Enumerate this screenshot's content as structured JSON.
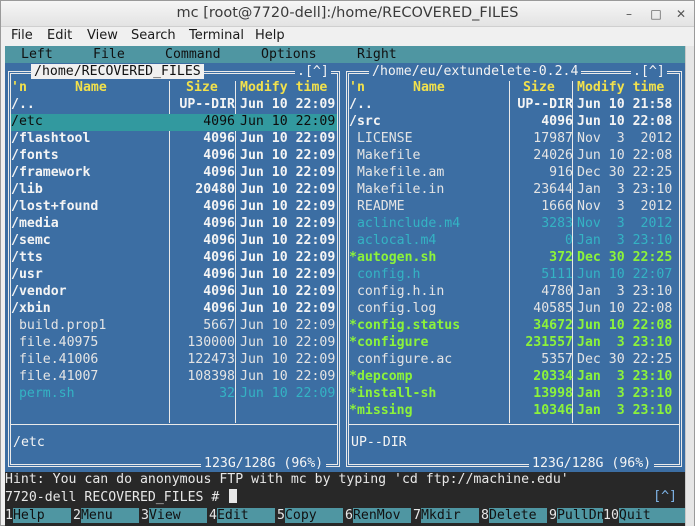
{
  "window": {
    "title": "mc [root@7720-dell]:/home/RECOVERED_FILES",
    "minimize": "–",
    "maximize": "□",
    "close": "✕"
  },
  "menubar": [
    "File",
    "Edit",
    "View",
    "Search",
    "Terminal",
    "Help"
  ],
  "mc_menu": [
    "Left",
    "File",
    "Command",
    "Options",
    "Right"
  ],
  "left_panel": {
    "path": "/home/RECOVERED_FILES",
    "corner": ".[^]",
    "headers": {
      "n": "'n",
      "name": "Name",
      "size": "Size",
      "mtime": "Modify time"
    },
    "rows": [
      {
        "name": "/..",
        "size": "UP--DIR",
        "date": "Jun 10 22:09",
        "kind": "dir"
      },
      {
        "name": "/etc",
        "size": "4096",
        "date": "Jun 10 22:09",
        "kind": "cursor"
      },
      {
        "name": "/flashtool",
        "size": "4096",
        "date": "Jun 10 22:09",
        "kind": "dir"
      },
      {
        "name": "/fonts",
        "size": "4096",
        "date": "Jun 10 22:09",
        "kind": "dir"
      },
      {
        "name": "/framework",
        "size": "4096",
        "date": "Jun 10 22:09",
        "kind": "dir"
      },
      {
        "name": "/lib",
        "size": "20480",
        "date": "Jun 10 22:09",
        "kind": "dir"
      },
      {
        "name": "/lost+found",
        "size": "4096",
        "date": "Jun 10 22:09",
        "kind": "dir"
      },
      {
        "name": "/media",
        "size": "4096",
        "date": "Jun 10 22:09",
        "kind": "dir"
      },
      {
        "name": "/semc",
        "size": "4096",
        "date": "Jun 10 22:09",
        "kind": "dir"
      },
      {
        "name": "/tts",
        "size": "4096",
        "date": "Jun 10 22:09",
        "kind": "dir"
      },
      {
        "name": "/usr",
        "size": "4096",
        "date": "Jun 10 22:09",
        "kind": "dir"
      },
      {
        "name": "/vendor",
        "size": "4096",
        "date": "Jun 10 22:09",
        "kind": "dir"
      },
      {
        "name": "/xbin",
        "size": "4096",
        "date": "Jun 10 22:09",
        "kind": "dir"
      },
      {
        "name": " build.prop1",
        "size": "5667",
        "date": "Jun 10 22:09",
        "kind": "file"
      },
      {
        "name": " file.40975",
        "size": "130000",
        "date": "Jun 10 22:09",
        "kind": "file"
      },
      {
        "name": " file.41006",
        "size": "122473",
        "date": "Jun 10 22:09",
        "kind": "file"
      },
      {
        "name": " file.41007",
        "size": "108398",
        "date": "Jun 10 22:09",
        "kind": "file"
      },
      {
        "name": " perm.sh",
        "size": "32",
        "date": "Jun 10 22:09",
        "kind": "dim"
      }
    ],
    "selected": "/etc",
    "disk": "123G/128G (96%)"
  },
  "right_panel": {
    "path": "/home/eu/extundelete-0.2.4",
    "corner": ".[^]",
    "headers": {
      "n": "'n",
      "name": "Name",
      "size": "Size",
      "mtime": "Modify time"
    },
    "rows": [
      {
        "name": "/..",
        "size": "UP--DIR",
        "date": "Jun 10 21:58",
        "kind": "dir"
      },
      {
        "name": "/src",
        "size": "4096",
        "date": "Jun 10 22:08",
        "kind": "dir"
      },
      {
        "name": " LICENSE",
        "size": "17987",
        "date": "Nov  3  2012",
        "kind": "file"
      },
      {
        "name": " Makefile",
        "size": "24026",
        "date": "Jun 10 22:08",
        "kind": "file"
      },
      {
        "name": " Makefile.am",
        "size": "916",
        "date": "Dec 30 22:25",
        "kind": "file"
      },
      {
        "name": " Makefile.in",
        "size": "23644",
        "date": "Jan  3 23:10",
        "kind": "file"
      },
      {
        "name": " README",
        "size": "1666",
        "date": "Nov  3  2012",
        "kind": "file"
      },
      {
        "name": " aclinclude.m4",
        "size": "3283",
        "date": "Nov  3  2012",
        "kind": "dim"
      },
      {
        "name": " aclocal.m4",
        "size": "0",
        "date": "Jan  3 23:10",
        "kind": "dim"
      },
      {
        "name": "*autogen.sh",
        "size": "372",
        "date": "Dec 30 22:25",
        "kind": "exec"
      },
      {
        "name": " config.h",
        "size": "5111",
        "date": "Jun 10 22:07",
        "kind": "dim"
      },
      {
        "name": " config.h.in",
        "size": "4780",
        "date": "Jan  3 23:10",
        "kind": "file"
      },
      {
        "name": " config.log",
        "size": "40585",
        "date": "Jun 10 22:08",
        "kind": "file"
      },
      {
        "name": "*config.status",
        "size": "34672",
        "date": "Jun 10 22:08",
        "kind": "exec"
      },
      {
        "name": "*configure",
        "size": "231557",
        "date": "Jan  3 23:10",
        "kind": "exec"
      },
      {
        "name": " configure.ac",
        "size": "5357",
        "date": "Dec 30 22:25",
        "kind": "file"
      },
      {
        "name": "*depcomp",
        "size": "20334",
        "date": "Jan  3 23:10",
        "kind": "exec"
      },
      {
        "name": "*install-sh",
        "size": "13998",
        "date": "Jan  3 23:10",
        "kind": "exec"
      },
      {
        "name": "*missing",
        "size": "10346",
        "date": "Jan  3 23:10",
        "kind": "exec"
      }
    ],
    "selected": "UP--DIR",
    "disk": "123G/128G (96%)"
  },
  "hint": "Hint: You can do anonymous FTP with mc by typing 'cd ftp://machine.edu'",
  "prompt": "7720-dell RECOVERED_FILES # ",
  "subshell": "[^]",
  "fkeys": [
    {
      "n": "1",
      "label": "Help"
    },
    {
      "n": "2",
      "label": "Menu"
    },
    {
      "n": "3",
      "label": "View"
    },
    {
      "n": "4",
      "label": "Edit"
    },
    {
      "n": "5",
      "label": "Copy"
    },
    {
      "n": "6",
      "label": "RenMov"
    },
    {
      "n": "7",
      "label": "Mkdir"
    },
    {
      "n": "8",
      "label": "Delete"
    },
    {
      "n": "9",
      "label": "PullDn"
    },
    {
      "n": "10",
      "label": "Quit"
    }
  ],
  "colors": {
    "panel_bg": "#3c6ea3",
    "menu_bg": "#4f96a2",
    "header": "#f2e14c",
    "exec": "#8cf33a",
    "dim": "#34b3c4"
  }
}
